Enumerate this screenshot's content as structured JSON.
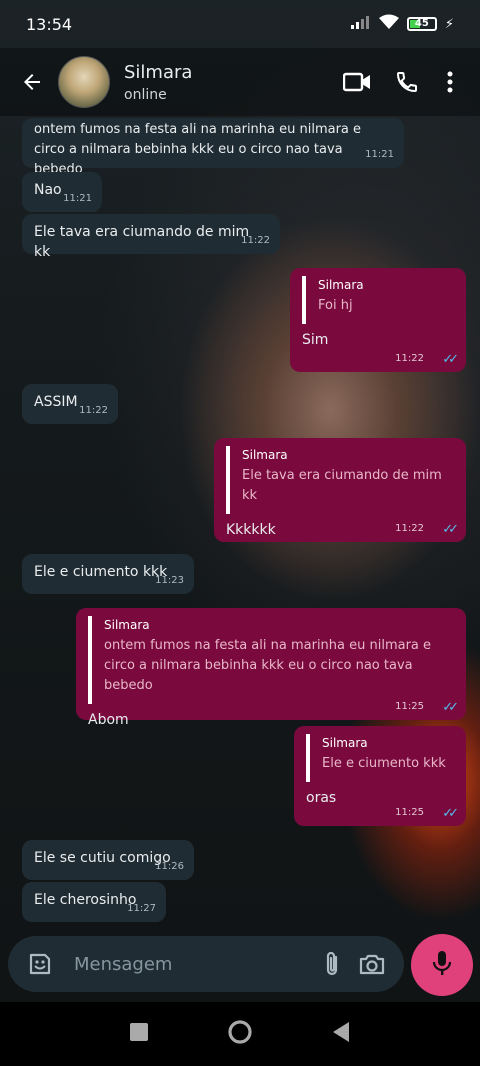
{
  "status": {
    "time": "13:54",
    "battery": "45"
  },
  "header": {
    "name": "Silmara",
    "state": "online"
  },
  "messages": [
    {
      "dir": "in",
      "text": "ontem fumos na festa ali na marinha eu nilmara e circo  a nilmara bebinha kkk eu o circo nao tava bebedo",
      "time": "11:21"
    },
    {
      "dir": "in",
      "text": "Nao",
      "time": "11:21"
    },
    {
      "dir": "in",
      "text": "Ele tava era ciumando de mim kk",
      "time": "11:22"
    },
    {
      "dir": "out",
      "quote_name": "Silmara",
      "quote_text": "Foi hj",
      "text": "Sim",
      "time": "11:22"
    },
    {
      "dir": "in",
      "text": "ASSIM",
      "time": "11:22"
    },
    {
      "dir": "out",
      "quote_name": "Silmara",
      "quote_text": "Ele tava era ciumando de mim kk",
      "text": "Kkkkkk",
      "time": "11:22"
    },
    {
      "dir": "in",
      "text": "Ele e ciumento kkk",
      "time": "11:23"
    },
    {
      "dir": "out",
      "quote_name": "Silmara",
      "quote_text": "ontem fumos na festa ali na marinha eu nilmara e circo  a nilmara bebinha kkk eu o circo nao tava bebedo",
      "text": "Abom",
      "time": "11:25"
    },
    {
      "dir": "out",
      "quote_name": "Silmara",
      "quote_text": "Ele e ciumento kkk",
      "text": "oras",
      "time": "11:25"
    },
    {
      "dir": "in",
      "text": "Ele se cutiu comigo",
      "time": "11:26"
    },
    {
      "dir": "in",
      "text": "Ele cherosinho",
      "time": "11:27"
    }
  ],
  "composer": {
    "placeholder": "Mensagem"
  },
  "colors": {
    "outgoing": "#7a0a3d",
    "incoming": "#202c33",
    "mic": "#e0417a",
    "read_ticks": "#53bdeb"
  }
}
